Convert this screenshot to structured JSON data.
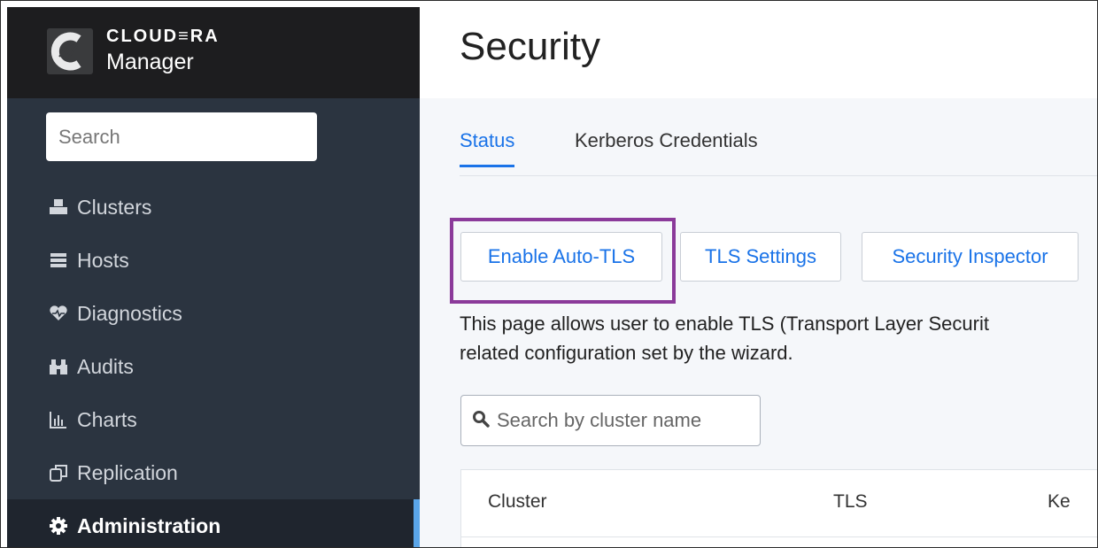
{
  "brand": {
    "name": "CLOUD≡RA",
    "product": "Manager"
  },
  "sidebar": {
    "search_placeholder": "Search",
    "items": [
      {
        "label": "Clusters",
        "icon": "cubes-icon"
      },
      {
        "label": "Hosts",
        "icon": "server-icon"
      },
      {
        "label": "Diagnostics",
        "icon": "heartbeat-icon"
      },
      {
        "label": "Audits",
        "icon": "binoculars-icon"
      },
      {
        "label": "Charts",
        "icon": "bar-chart-icon"
      },
      {
        "label": "Replication",
        "icon": "replication-icon"
      },
      {
        "label": "Administration",
        "icon": "gear-icon",
        "active": true
      }
    ]
  },
  "page": {
    "title": "Security"
  },
  "tabs": [
    {
      "label": "Status",
      "active": true
    },
    {
      "label": "Kerberos Credentials",
      "active": false
    }
  ],
  "actions": {
    "enable_auto_tls": "Enable Auto-TLS",
    "tls_settings": "TLS Settings",
    "security_inspector": "Security Inspector"
  },
  "description": {
    "line1": "This page allows user to enable TLS (Transport Layer Securit",
    "line2": "related configuration set by the wizard."
  },
  "cluster_search": {
    "placeholder": "Search by cluster name"
  },
  "table": {
    "headers": [
      "Cluster",
      "TLS",
      "Ke"
    ]
  },
  "colors": {
    "accent": "#1a73e8",
    "highlight": "#8b3a9a",
    "sidebar_bg": "#2b3440",
    "active_bar": "#5aa5e8"
  }
}
